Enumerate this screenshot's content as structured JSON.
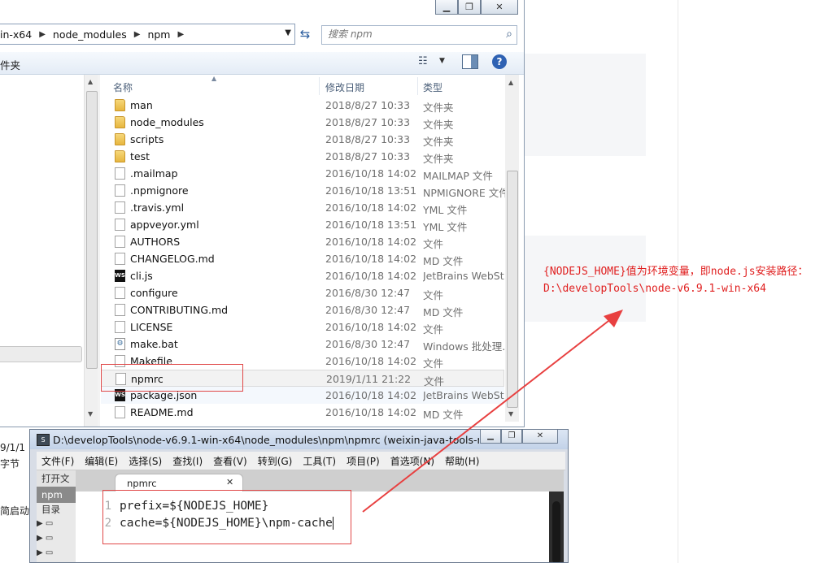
{
  "explorer": {
    "breadcrumb": [
      "in-x64",
      "node_modules",
      "npm"
    ],
    "search_placeholder": "搜索 npm",
    "toolbar_label": "件夹",
    "columns": {
      "name": "名称",
      "date": "修改日期",
      "type": "类型"
    },
    "files": [
      {
        "icon": "folder",
        "name": "man",
        "date": "2018/8/27 10:33",
        "type": "文件夹"
      },
      {
        "icon": "folder",
        "name": "node_modules",
        "date": "2018/8/27 10:33",
        "type": "文件夹"
      },
      {
        "icon": "folder",
        "name": "scripts",
        "date": "2018/8/27 10:33",
        "type": "文件夹"
      },
      {
        "icon": "folder",
        "name": "test",
        "date": "2018/8/27 10:33",
        "type": "文件夹"
      },
      {
        "icon": "file",
        "name": ".mailmap",
        "date": "2016/10/18 14:02",
        "type": "MAILMAP 文件"
      },
      {
        "icon": "file",
        "name": ".npmignore",
        "date": "2016/10/18 13:51",
        "type": "NPMIGNORE 文件"
      },
      {
        "icon": "file",
        "name": ".travis.yml",
        "date": "2016/10/18 14:02",
        "type": "YML 文件"
      },
      {
        "icon": "file",
        "name": "appveyor.yml",
        "date": "2016/10/18 13:51",
        "type": "YML 文件"
      },
      {
        "icon": "file",
        "name": "AUTHORS",
        "date": "2016/10/18 14:02",
        "type": "文件"
      },
      {
        "icon": "file",
        "name": "CHANGELOG.md",
        "date": "2016/10/18 14:02",
        "type": "MD 文件"
      },
      {
        "icon": "ws",
        "name": "cli.js",
        "date": "2016/10/18 14:02",
        "type": "JetBrains WebSt..."
      },
      {
        "icon": "file",
        "name": "configure",
        "date": "2016/8/30 12:47",
        "type": "文件"
      },
      {
        "icon": "file",
        "name": "CONTRIBUTING.md",
        "date": "2016/8/30 12:47",
        "type": "MD 文件"
      },
      {
        "icon": "file",
        "name": "LICENSE",
        "date": "2016/10/18 14:02",
        "type": "文件"
      },
      {
        "icon": "bat",
        "name": "make.bat",
        "date": "2016/8/30 12:47",
        "type": "Windows 批处理..."
      },
      {
        "icon": "file",
        "name": "Makefile",
        "date": "2016/10/18 14:02",
        "type": "文件"
      },
      {
        "icon": "file",
        "name": "npmrc",
        "date": "2019/1/11 21:22",
        "type": "文件",
        "state": "selected"
      },
      {
        "icon": "ws",
        "name": "package.json",
        "date": "2016/10/18 14:02",
        "type": "JetBrains WebSt...",
        "state": "hover"
      },
      {
        "icon": "file",
        "name": "README.md",
        "date": "2016/10/18 14:02",
        "type": "MD 文件"
      }
    ]
  },
  "editor": {
    "title": "D:\\developTools\\node-v6.9.1-win-x64\\node_modules\\npm\\npmrc (weixin-java-tools-ma...",
    "menu": [
      "文件(F)",
      "编辑(E)",
      "选择(S)",
      "查找(I)",
      "查看(V)",
      "转到(G)",
      "工具(T)",
      "项目(P)",
      "首选项(N)",
      "帮助(H)"
    ],
    "side_open": "打开文",
    "side_active": "npm",
    "side_dir": "目录",
    "tab_label": "npmrc",
    "lines": [
      {
        "num": "1",
        "text": "prefix=${NODEJS_HOME}"
      },
      {
        "num": "2",
        "text": "cache=${NODEJS_HOME}\\npm-cache"
      }
    ]
  },
  "background": {
    "left_date": "9/1/1",
    "left_bytes": "字节",
    "left_start": "简启动"
  },
  "annotation": {
    "text": "{NODEJS_HOME}值为环境变量，即node.js安装路径：D:\\developTools\\node-v6.9.1-win-x64"
  },
  "colors": {
    "annotation": "#e02020",
    "selection": "#f2f2f2",
    "folder": "#e7b63f"
  }
}
